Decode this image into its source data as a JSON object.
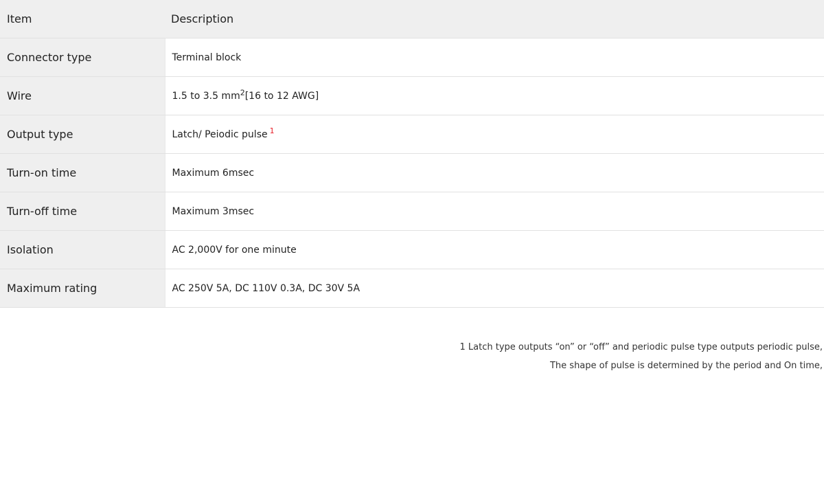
{
  "table": {
    "headers": {
      "item": "Item",
      "description": "Description"
    },
    "rows": [
      {
        "item": "Connector type",
        "desc": "Terminal block"
      },
      {
        "item": "Wire",
        "desc_pre": "1.5 to 3.5 mm",
        "desc_sup": "2",
        "desc_post": "[16 to 12 AWG]"
      },
      {
        "item": "Output type",
        "desc": "Latch/ Peiodic pulse",
        "footnote_ref": "1"
      },
      {
        "item": "Turn-on time",
        "desc": "Maximum 6msec"
      },
      {
        "item": "Turn-off time",
        "desc": "Maximum 3msec"
      },
      {
        "item": "Isolation",
        "desc": "AC 2,000V for one minute"
      },
      {
        "item": "Maximum rating",
        "desc": "AC 250V 5A, DC 110V 0.3A, DC 30V 5A"
      }
    ]
  },
  "footnotes": [
    "1 Latch type outputs “on” or “off” and periodic pulse type outputs periodic pulse,",
    "The shape of pulse is determined by the period and On time,"
  ],
  "colors": {
    "header_bg": "#efefef",
    "item_bg": "#efefef",
    "border": "#e1e1e1",
    "footnote_ref": "#e8202a"
  }
}
